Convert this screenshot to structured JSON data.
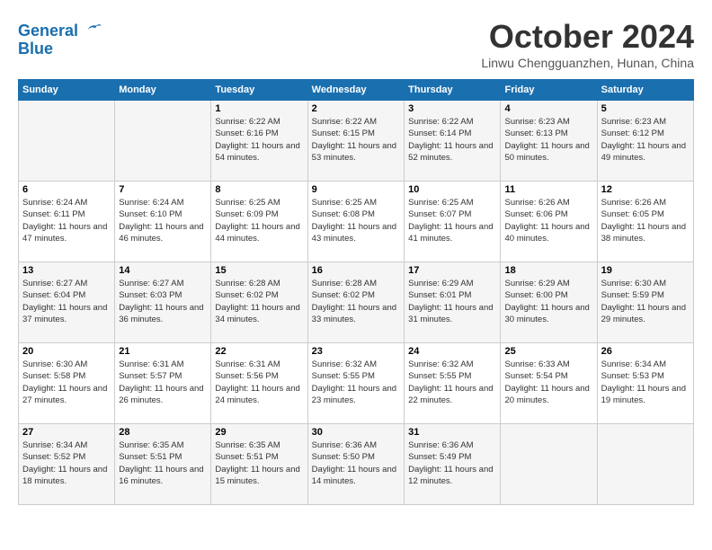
{
  "header": {
    "logo_line1": "General",
    "logo_line2": "Blue",
    "month": "October 2024",
    "location": "Linwu Chengguanzhen, Hunan, China"
  },
  "days_of_week": [
    "Sunday",
    "Monday",
    "Tuesday",
    "Wednesday",
    "Thursday",
    "Friday",
    "Saturday"
  ],
  "weeks": [
    [
      {
        "num": "",
        "sunrise": "",
        "sunset": "",
        "daylight": ""
      },
      {
        "num": "",
        "sunrise": "",
        "sunset": "",
        "daylight": ""
      },
      {
        "num": "1",
        "sunrise": "Sunrise: 6:22 AM",
        "sunset": "Sunset: 6:16 PM",
        "daylight": "Daylight: 11 hours and 54 minutes."
      },
      {
        "num": "2",
        "sunrise": "Sunrise: 6:22 AM",
        "sunset": "Sunset: 6:15 PM",
        "daylight": "Daylight: 11 hours and 53 minutes."
      },
      {
        "num": "3",
        "sunrise": "Sunrise: 6:22 AM",
        "sunset": "Sunset: 6:14 PM",
        "daylight": "Daylight: 11 hours and 52 minutes."
      },
      {
        "num": "4",
        "sunrise": "Sunrise: 6:23 AM",
        "sunset": "Sunset: 6:13 PM",
        "daylight": "Daylight: 11 hours and 50 minutes."
      },
      {
        "num": "5",
        "sunrise": "Sunrise: 6:23 AM",
        "sunset": "Sunset: 6:12 PM",
        "daylight": "Daylight: 11 hours and 49 minutes."
      }
    ],
    [
      {
        "num": "6",
        "sunrise": "Sunrise: 6:24 AM",
        "sunset": "Sunset: 6:11 PM",
        "daylight": "Daylight: 11 hours and 47 minutes."
      },
      {
        "num": "7",
        "sunrise": "Sunrise: 6:24 AM",
        "sunset": "Sunset: 6:10 PM",
        "daylight": "Daylight: 11 hours and 46 minutes."
      },
      {
        "num": "8",
        "sunrise": "Sunrise: 6:25 AM",
        "sunset": "Sunset: 6:09 PM",
        "daylight": "Daylight: 11 hours and 44 minutes."
      },
      {
        "num": "9",
        "sunrise": "Sunrise: 6:25 AM",
        "sunset": "Sunset: 6:08 PM",
        "daylight": "Daylight: 11 hours and 43 minutes."
      },
      {
        "num": "10",
        "sunrise": "Sunrise: 6:25 AM",
        "sunset": "Sunset: 6:07 PM",
        "daylight": "Daylight: 11 hours and 41 minutes."
      },
      {
        "num": "11",
        "sunrise": "Sunrise: 6:26 AM",
        "sunset": "Sunset: 6:06 PM",
        "daylight": "Daylight: 11 hours and 40 minutes."
      },
      {
        "num": "12",
        "sunrise": "Sunrise: 6:26 AM",
        "sunset": "Sunset: 6:05 PM",
        "daylight": "Daylight: 11 hours and 38 minutes."
      }
    ],
    [
      {
        "num": "13",
        "sunrise": "Sunrise: 6:27 AM",
        "sunset": "Sunset: 6:04 PM",
        "daylight": "Daylight: 11 hours and 37 minutes."
      },
      {
        "num": "14",
        "sunrise": "Sunrise: 6:27 AM",
        "sunset": "Sunset: 6:03 PM",
        "daylight": "Daylight: 11 hours and 36 minutes."
      },
      {
        "num": "15",
        "sunrise": "Sunrise: 6:28 AM",
        "sunset": "Sunset: 6:02 PM",
        "daylight": "Daylight: 11 hours and 34 minutes."
      },
      {
        "num": "16",
        "sunrise": "Sunrise: 6:28 AM",
        "sunset": "Sunset: 6:02 PM",
        "daylight": "Daylight: 11 hours and 33 minutes."
      },
      {
        "num": "17",
        "sunrise": "Sunrise: 6:29 AM",
        "sunset": "Sunset: 6:01 PM",
        "daylight": "Daylight: 11 hours and 31 minutes."
      },
      {
        "num": "18",
        "sunrise": "Sunrise: 6:29 AM",
        "sunset": "Sunset: 6:00 PM",
        "daylight": "Daylight: 11 hours and 30 minutes."
      },
      {
        "num": "19",
        "sunrise": "Sunrise: 6:30 AM",
        "sunset": "Sunset: 5:59 PM",
        "daylight": "Daylight: 11 hours and 29 minutes."
      }
    ],
    [
      {
        "num": "20",
        "sunrise": "Sunrise: 6:30 AM",
        "sunset": "Sunset: 5:58 PM",
        "daylight": "Daylight: 11 hours and 27 minutes."
      },
      {
        "num": "21",
        "sunrise": "Sunrise: 6:31 AM",
        "sunset": "Sunset: 5:57 PM",
        "daylight": "Daylight: 11 hours and 26 minutes."
      },
      {
        "num": "22",
        "sunrise": "Sunrise: 6:31 AM",
        "sunset": "Sunset: 5:56 PM",
        "daylight": "Daylight: 11 hours and 24 minutes."
      },
      {
        "num": "23",
        "sunrise": "Sunrise: 6:32 AM",
        "sunset": "Sunset: 5:55 PM",
        "daylight": "Daylight: 11 hours and 23 minutes."
      },
      {
        "num": "24",
        "sunrise": "Sunrise: 6:32 AM",
        "sunset": "Sunset: 5:55 PM",
        "daylight": "Daylight: 11 hours and 22 minutes."
      },
      {
        "num": "25",
        "sunrise": "Sunrise: 6:33 AM",
        "sunset": "Sunset: 5:54 PM",
        "daylight": "Daylight: 11 hours and 20 minutes."
      },
      {
        "num": "26",
        "sunrise": "Sunrise: 6:34 AM",
        "sunset": "Sunset: 5:53 PM",
        "daylight": "Daylight: 11 hours and 19 minutes."
      }
    ],
    [
      {
        "num": "27",
        "sunrise": "Sunrise: 6:34 AM",
        "sunset": "Sunset: 5:52 PM",
        "daylight": "Daylight: 11 hours and 18 minutes."
      },
      {
        "num": "28",
        "sunrise": "Sunrise: 6:35 AM",
        "sunset": "Sunset: 5:51 PM",
        "daylight": "Daylight: 11 hours and 16 minutes."
      },
      {
        "num": "29",
        "sunrise": "Sunrise: 6:35 AM",
        "sunset": "Sunset: 5:51 PM",
        "daylight": "Daylight: 11 hours and 15 minutes."
      },
      {
        "num": "30",
        "sunrise": "Sunrise: 6:36 AM",
        "sunset": "Sunset: 5:50 PM",
        "daylight": "Daylight: 11 hours and 14 minutes."
      },
      {
        "num": "31",
        "sunrise": "Sunrise: 6:36 AM",
        "sunset": "Sunset: 5:49 PM",
        "daylight": "Daylight: 11 hours and 12 minutes."
      },
      {
        "num": "",
        "sunrise": "",
        "sunset": "",
        "daylight": ""
      },
      {
        "num": "",
        "sunrise": "",
        "sunset": "",
        "daylight": ""
      }
    ]
  ]
}
